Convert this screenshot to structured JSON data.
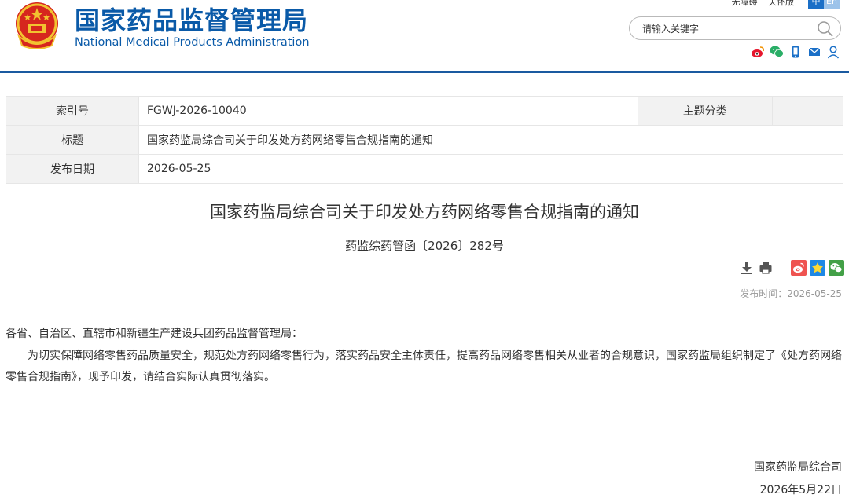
{
  "header": {
    "title_cn": "国家药品监督管理局",
    "title_en": "National Medical Products Administration",
    "top_links": [
      "无障碍",
      "关怀版"
    ],
    "lang": {
      "cn": "中",
      "en": "En"
    },
    "search": {
      "placeholder": "请输入关键字"
    },
    "social_icons": [
      "weibo-icon",
      "wechat-icon",
      "mobile-icon",
      "mail-icon",
      "user-icon"
    ],
    "brand_color": "#0a5aa8"
  },
  "info": {
    "index_label": "索引号",
    "index_value": "FGWJ-2026-10040",
    "category_label": "主题分类",
    "category_value": "",
    "title_label": "标题",
    "title_value": "国家药监局综合司关于印发处方药网络零售合规指南的通知",
    "date_label": "发布日期",
    "date_value": "2026-05-25"
  },
  "article": {
    "title": "国家药监局综合司关于印发处方药网络零售合规指南的通知",
    "doc_number": "药监综药管函〔2026〕282号",
    "publish_label": "发布时间：",
    "publish_date": "2026-05-25",
    "tools": [
      "download-icon",
      "print-icon"
    ],
    "share": [
      "weibo-share-icon",
      "favorite-icon",
      "wechat-share-icon"
    ],
    "salutation": "各省、自治区、直辖市和新疆生产建设兵团药品监督管理局：",
    "paragraph": "为切实保障网络零售药品质量安全，规范处方药网络零售行为，落实药品安全主体责任，提高药品网络零售相关从业者的合规意识，国家药监局组织制定了《处方药网络零售合规指南》，现予印发，请结合实际认真贯彻落实。",
    "signature": "国家药监局综合司",
    "sign_date": "2026年5月22日"
  }
}
